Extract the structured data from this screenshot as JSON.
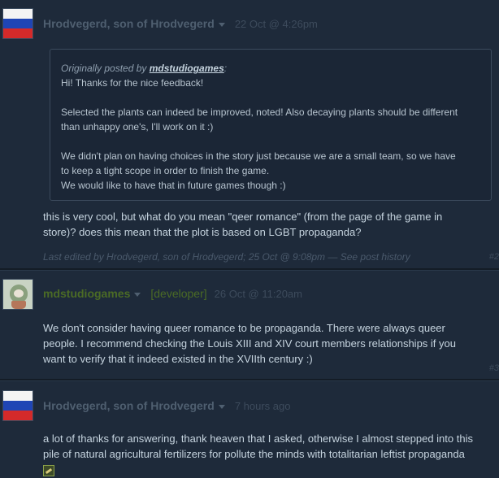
{
  "posts": [
    {
      "author": "Hrodvegerd, son of Hrodvegerd",
      "timestamp": "22 Oct @ 4:26pm",
      "quote": {
        "prefix": "Originally posted by ",
        "author": "mdstudiogames",
        "suffix": ":",
        "paragraphs": [
          [
            "Hi! Thanks for the nice feedback!"
          ],
          [
            "Selected the plants can indeed be improved, noted! Also decaying plants should be different",
            "than unhappy one's, I'll work on it :)"
          ],
          [
            "We didn't plan on having choices in the story just because we are a small team, so we have",
            "to keep a tight scope in order to finish the game.",
            "We would like to have that in future games though :)"
          ]
        ]
      },
      "body_lines": [
        "this is very cool, but what do you mean \"qeer romance\" (from the page of the game in",
        "store)? does this mean that the plot is based on LGBT propaganda?"
      ],
      "edited": {
        "prefix": "Last edited by Hrodvegerd, son of Hrodvegerd; 25 Oct @ 9:08pm — ",
        "link": "See post history"
      },
      "number": "#2"
    },
    {
      "author": "mdstudiogames",
      "role": "[developer]",
      "timestamp": "26 Oct @ 11:20am",
      "body_lines": [
        "We don't consider having queer romance to be propaganda. There were always queer",
        "people. I recommend checking the Louis XIII and XIV court members relationships if you",
        "want to verify that it indeed existed in the XVIIth century :)"
      ],
      "number": "#3"
    },
    {
      "author": "Hrodvegerd, son of Hrodvegerd",
      "timestamp": "7 hours ago",
      "body_lines": [
        "a lot of thanks for answering, thank heaven that I asked, otherwise I almost stepped into this",
        "pile of natural agricultural fertilizers for pollute the minds with totalitarian leftist propaganda"
      ],
      "emoticon": "steam-emoticon-icon"
    }
  ],
  "colors": {
    "background": "#1e2a3a",
    "developer_green": "#4b6b25",
    "muted_author": "#4f5f70"
  }
}
